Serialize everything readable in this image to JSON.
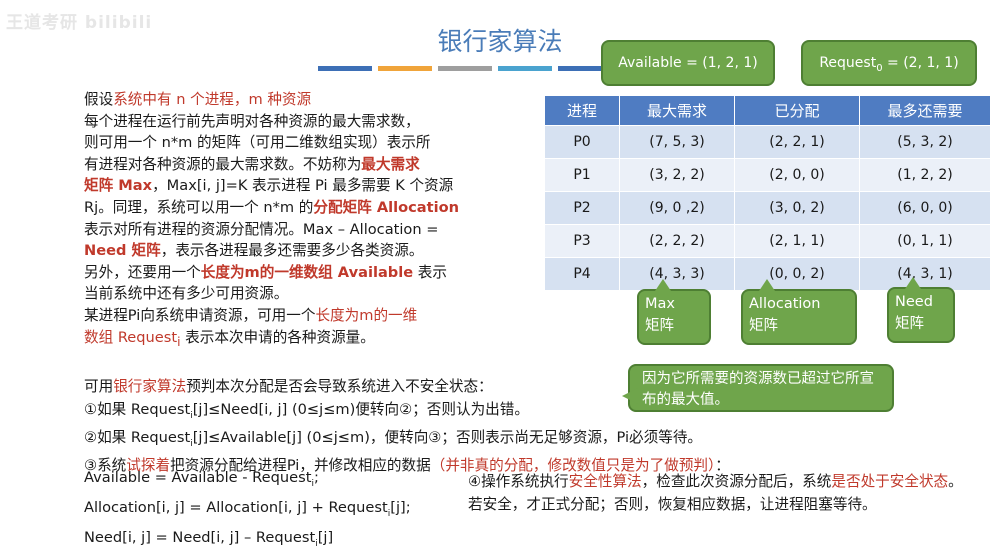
{
  "title": "银行家算法",
  "watermark": "王道考研 bilibili",
  "available_box": "Available = (1, 2, 1)",
  "request_box": {
    "label": "Request",
    "sub": "0",
    "value": " = (2, 1, 1)"
  },
  "paragraph": {
    "l1a": "假设",
    "l1b": "系统中有 n 个进程，m 种资源",
    "l2": "每个进程在运行前先声明对各种资源的最大需求数，",
    "l3": "则可用一个 n*m 的矩阵（可用二维数组实现）表示所",
    "l4a": "有进程对各种资源的最大需求数。不妨称为",
    "l4b": "最大需求",
    "l5a": "矩阵 Max",
    "l5b": "，Max[i, j]=K 表示进程 Pi 最多需要 K 个资源",
    "l6a": "Rj。同理，系统可以用一个 n*m 的",
    "l6b": "分配矩阵 Allocation",
    "l7": "表示对所有进程的资源分配情况。Max – Allocation =",
    "l8a": "Need 矩阵",
    "l8b": "，表示各进程最多还需要多少各类资源。",
    "l9a": "另外，还要用一个",
    "l9b": "长度为m的一维数组 Available",
    "l9c": " 表示",
    "l10": "当前系统中还有多少可用资源。",
    "l11a": "某进程Pi向系统申请资源，可用一个",
    "l11b": "长度为m的一维",
    "l12a": "数组 Request",
    "l12sub": "i",
    "l12b": " 表示本次申请的各种资源量。"
  },
  "table": {
    "headers": [
      "进程",
      "最大需求",
      "已分配",
      "最多还需要"
    ],
    "rows": [
      [
        "P0",
        "(7, 5, 3)",
        "(2, 2, 1)",
        "(5, 3, 2)"
      ],
      [
        "P1",
        "(3, 2, 2)",
        "(2, 0, 0)",
        "(1, 2, 2)"
      ],
      [
        "P2",
        "(9, 0 ,2)",
        "(3, 0, 2)",
        "(6, 0, 0)"
      ],
      [
        "P3",
        "(2, 2, 2)",
        "(2, 1, 1)",
        "(0, 1, 1)"
      ],
      [
        "P4",
        "(4, 3, 3)",
        "(0, 0, 2)",
        "(4, 3, 1)"
      ]
    ]
  },
  "labels": {
    "max": [
      "Max",
      "矩阵"
    ],
    "alloc": [
      "Allocation",
      "矩阵"
    ],
    "need": [
      "Need",
      "矩阵"
    ],
    "note": "因为它所需要的资源数已超过它所宣布的最大值。"
  },
  "steps": {
    "intro_a": "可用",
    "intro_b": "银行家算法",
    "intro_c": "预判本次分配是否会导致系统进入不安全状态：",
    "s1a": "①如果 Request",
    "s1b": "[j]≤Need[i, j] (0≤j≤m)便转向②；否则认为出错。",
    "s2a": "②如果 Request",
    "s2b": "[j]≤Available[j] (0≤j≤m)，便转向③；否则表示尚无足够资源，Pi必须等待。",
    "s3a": "③系统",
    "s3b": "试探着",
    "s3c": "把资源分配给进程Pi，并修改相应的数据",
    "s3d": "（并非真的分配，修改数值只是为了做预判）",
    "s3e": "：",
    "sub_i": "i"
  },
  "formulas": {
    "f1a": "Available = Available - Request",
    "f1b": ";",
    "f2a": "Allocation[i, j] = Allocation[i, j] + Request",
    "f2b": "[j];",
    "f3a": "Need[i, j] = Need[i, j] – Request",
    "f3b": "[j]"
  },
  "step4": {
    "a": "④操作系统执行",
    "b": "安全性算法",
    "c": "，检查此次资源分配后，系统",
    "d": "是否处于安全状态",
    "e": "。若安全，才正式分配；否则，恢复相应数据，让进程阻塞等待。"
  },
  "colors": {
    "title": "#4a7cb8",
    "callout": "#6fa54b",
    "highlight": "#c0392b",
    "table_header": "#4f7cc2",
    "stripes": [
      "#3d6fb6",
      "#f0a43a",
      "#9e9e9e",
      "#4aa3cf",
      "#3d6fb6"
    ]
  }
}
